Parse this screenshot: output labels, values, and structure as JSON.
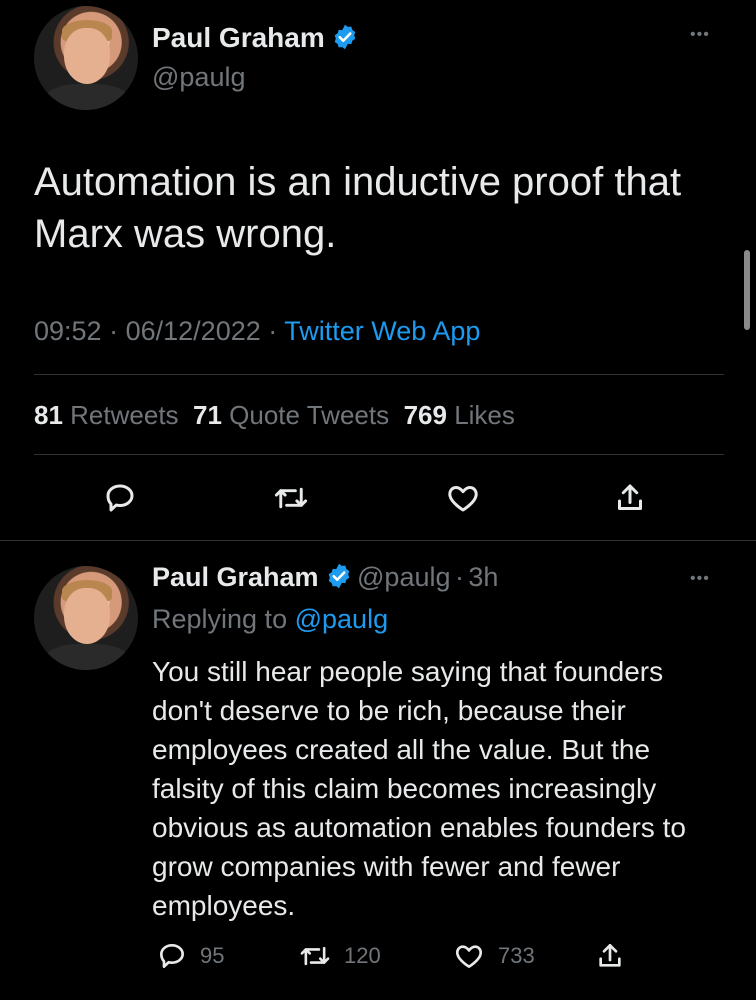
{
  "main_tweet": {
    "author_name": "Paul Graham",
    "handle": "@paulg",
    "text": "Automation is an inductive proof that Marx was wrong.",
    "time": "09:52",
    "date": "06/12/2022",
    "source": "Twitter Web App",
    "stats": {
      "retweets_count": "81",
      "retweets_label": "Retweets",
      "quotes_count": "71",
      "quotes_label": "Quote Tweets",
      "likes_count": "769",
      "likes_label": "Likes"
    }
  },
  "reply_tweet": {
    "author_name": "Paul Graham",
    "handle": "@paulg",
    "age": "3h",
    "replying_prefix": "Replying to",
    "replying_to": "@paulg",
    "text": "You still hear people saying that founders don't deserve to be rich, because their employees created all the value. But the falsity of this claim becomes increasingly obvious as automation enables founders to grow companies with fewer and fewer employees.",
    "reply_count": "95",
    "retweet_count": "120",
    "like_count": "733"
  },
  "separator_dot": "·",
  "more_glyph": "•••",
  "colors": {
    "background": "#000000",
    "text": "#e7e9ea",
    "secondary": "#71767b",
    "accent": "#1d9bf0",
    "divider": "#2f3336"
  }
}
